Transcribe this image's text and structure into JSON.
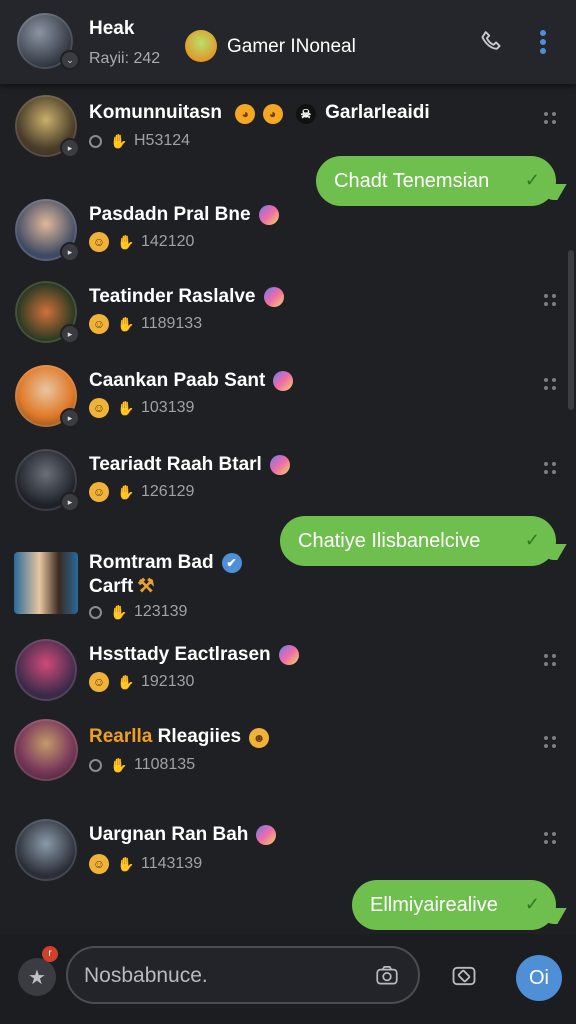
{
  "header": {
    "name": "Heak",
    "subtitle": "Rayii: 242",
    "group_name": "Gamer INoneal"
  },
  "chats": [
    {
      "name": "Komunnuitasn",
      "extra": "Garlarleaidi",
      "meta": "H53124",
      "icon": "circle"
    },
    {
      "name": "Pasdadn Pral Bne",
      "meta": "142120",
      "icon": "emoji"
    },
    {
      "name": "Teatinder Raslalve",
      "meta": "1189133",
      "icon": "emoji"
    },
    {
      "name": "Caankan Paab Sant",
      "meta": "103139",
      "icon": "emoji"
    },
    {
      "name": "Teariadt Raah Btarl",
      "meta": "126129",
      "icon": "emoji"
    },
    {
      "name": "Romtram Bad",
      "name2": "Carft",
      "meta": "123139",
      "icon": "circle"
    },
    {
      "name": "Hssttady Eactlrasen",
      "meta": "192130",
      "icon": "emoji"
    },
    {
      "name_accent": "Rearlla",
      "name_rest": "Rleagiies",
      "meta": "1108135",
      "icon": "circle"
    },
    {
      "name": "Uargnan Ran Bah",
      "meta": "1143139",
      "icon": "emoji"
    }
  ],
  "bubbles": [
    "Chadt Tenemsian",
    "Chatiye Ilisbanelcive",
    "Ellmiyairealive"
  ],
  "composer": {
    "placeholder": "Nosbabnuce.",
    "send_label": "Oi",
    "notif_count": "r"
  },
  "colors": {
    "bubble": "#6fbf4e",
    "accent": "#4f8fd6",
    "name_accent": "#f0a020"
  }
}
